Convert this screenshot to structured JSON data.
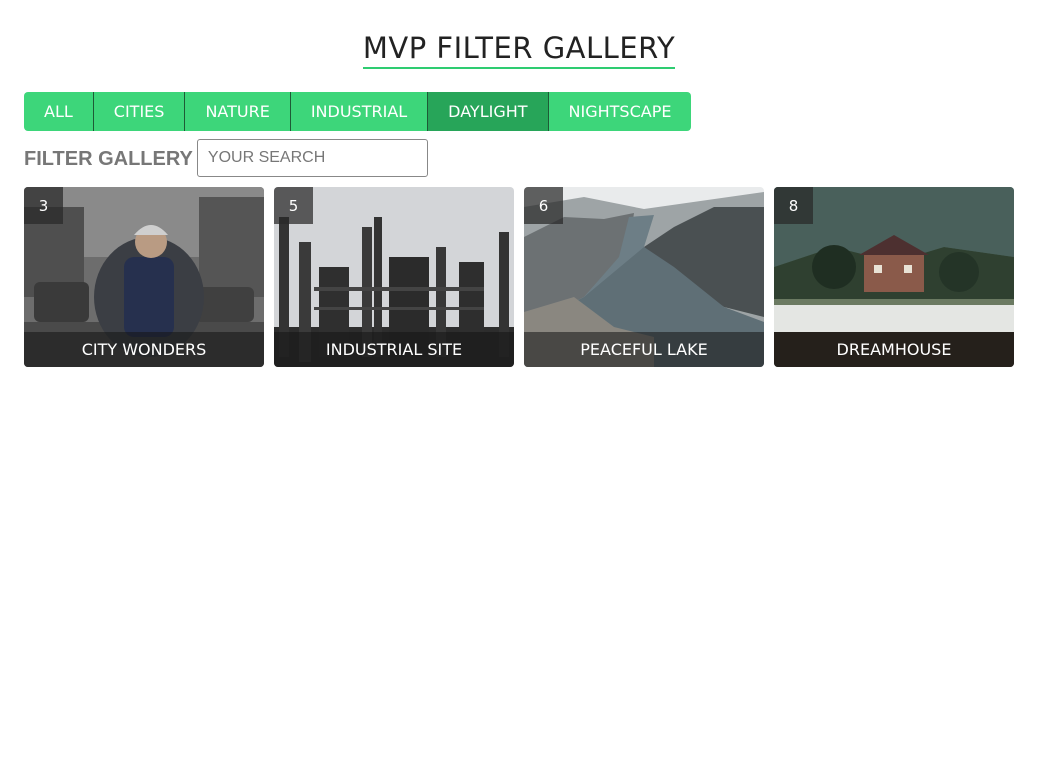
{
  "header": {
    "title": "MVP FILTER GALLERY"
  },
  "filters": [
    {
      "label": "ALL"
    },
    {
      "label": "CITIES"
    },
    {
      "label": "NATURE"
    },
    {
      "label": "INDUSTRIAL"
    },
    {
      "label": "DAYLIGHT",
      "active": true
    },
    {
      "label": "NIGHTSCAPE"
    }
  ],
  "search": {
    "label": "FILTER GALLERY",
    "placeholder": "YOUR SEARCH",
    "value": ""
  },
  "gallery": [
    {
      "id": "3",
      "title": "CITY WONDERS"
    },
    {
      "id": "5",
      "title": "INDUSTRIAL SITE"
    },
    {
      "id": "6",
      "title": "PEACEFUL LAKE"
    },
    {
      "id": "8",
      "title": "DREAMHOUSE"
    }
  ],
  "colors": {
    "accent": "#3dd67a",
    "accent_active": "#27a559",
    "underline": "#2ecc71"
  }
}
